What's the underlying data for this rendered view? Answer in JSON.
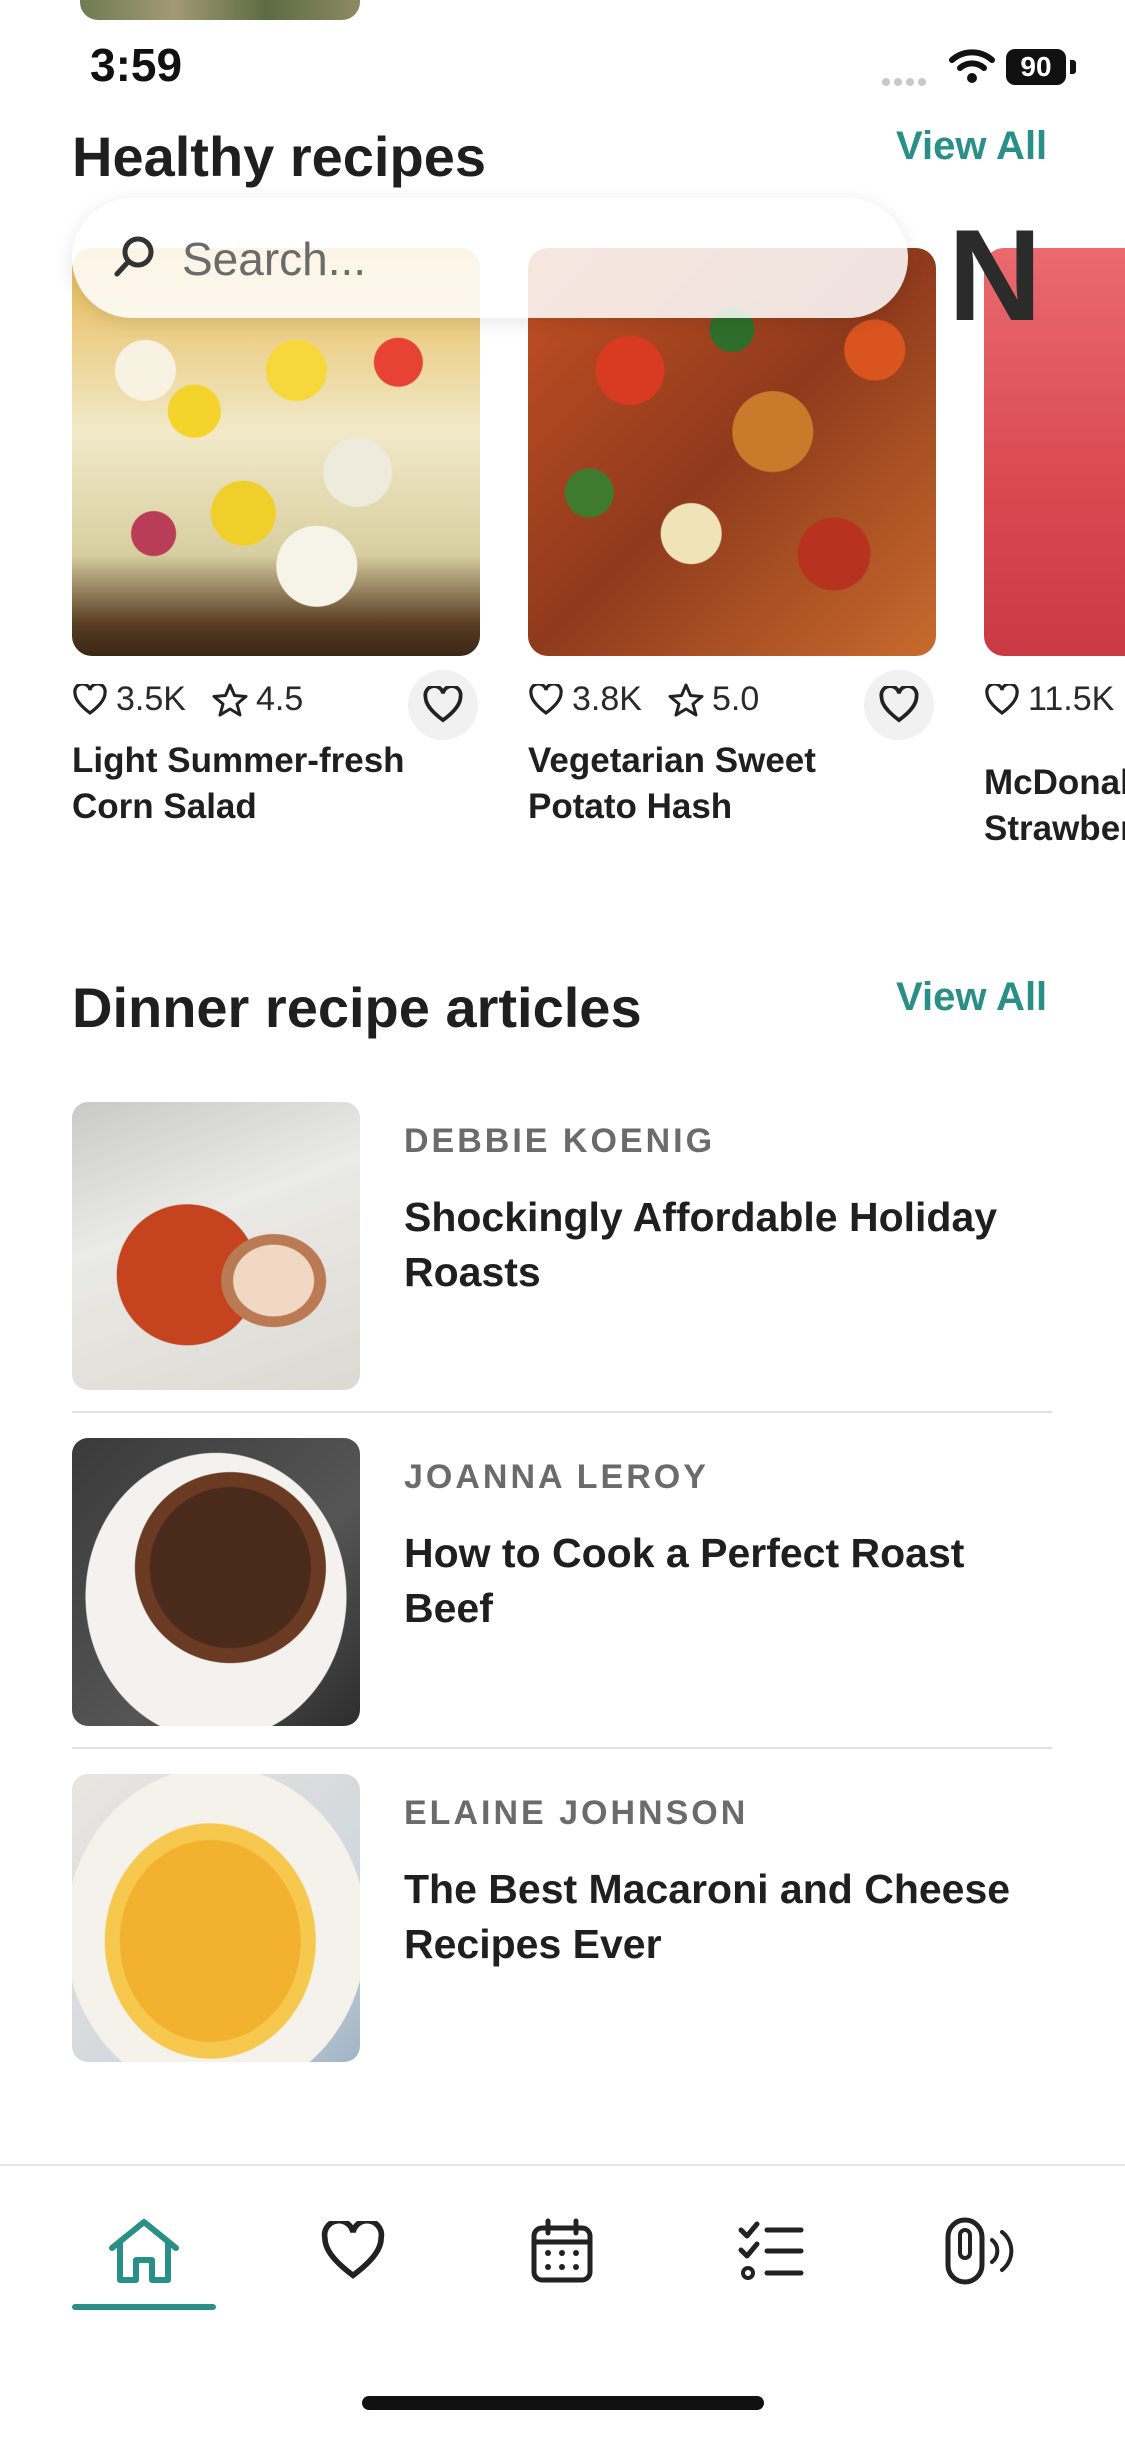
{
  "status_bar": {
    "time": "3:59",
    "battery": "90"
  },
  "search": {
    "placeholder": "Search..."
  },
  "overlay": {
    "logo_letter": "N"
  },
  "healthy": {
    "title": "Healthy recipes",
    "view_all": "View All",
    "cards": [
      {
        "likes": "3.5K",
        "rating": "4.5",
        "title": "Light Summer-fresh Corn Salad"
      },
      {
        "likes": "3.8K",
        "rating": "5.0",
        "title": "Vegetarian Sweet Potato Hash"
      },
      {
        "likes": "11.5K",
        "title": "McDonal Strawber"
      }
    ]
  },
  "dinner": {
    "title": "Dinner recipe articles",
    "view_all": "View All",
    "articles": [
      {
        "author": "DEBBIE KOENIG",
        "title": "Shockingly Affordable Holiday Roasts"
      },
      {
        "author": "JOANNA LEROY",
        "title": "How to Cook a Perfect Roast Beef"
      },
      {
        "author": "ELAINE JOHNSON",
        "title": "The Best Macaroni and Cheese Recipes Ever"
      }
    ]
  },
  "nav": {
    "active": "home",
    "items": [
      "home-icon",
      "heart-icon",
      "calendar-icon",
      "checklist-icon",
      "device-icon"
    ]
  },
  "colors": {
    "accent": "#2a8f87",
    "text": "#1f1f1f",
    "muted": "#6b6b6b"
  }
}
